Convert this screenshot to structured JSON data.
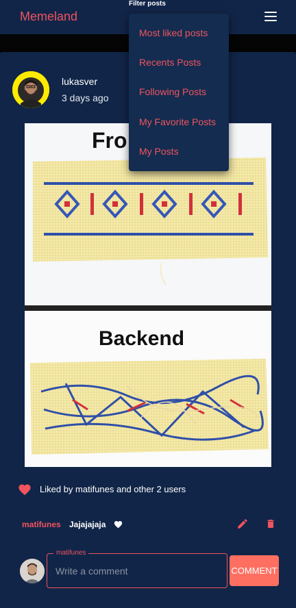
{
  "app": {
    "title": "Memeland"
  },
  "filter": {
    "label": "Filter posts",
    "options": [
      "Most liked posts",
      "Recents Posts",
      "Following Posts",
      "My Favorite Posts",
      "My Posts"
    ]
  },
  "post": {
    "author": "lukasver",
    "time": "3 days ago",
    "image": {
      "top_caption": "Fro",
      "bottom_caption": "Backend"
    },
    "likes_text": "Liked by matifunes and other 2 users"
  },
  "comment": {
    "author": "matifunes",
    "text": "Jajajajaja"
  },
  "new_comment": {
    "label": "matifunes",
    "placeholder": "Write a comment",
    "button_label": "COMMENT"
  },
  "colors": {
    "accent": "#f0545e",
    "button": "#ff6f61",
    "appbar": "#112548",
    "background": "#0b1a30"
  },
  "icons": [
    "menu-icon",
    "heart-icon",
    "edit-icon",
    "delete-icon"
  ]
}
